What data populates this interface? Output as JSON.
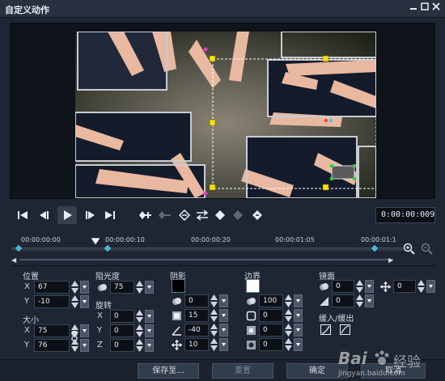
{
  "window": {
    "title": "自定义动作",
    "min_icon": "minimize-icon",
    "max_icon": "maximize-icon",
    "close_icon": "close-icon"
  },
  "transport": {
    "timecode": "0:00:00:009"
  },
  "timeline": {
    "ticks": [
      "00:00:00:00",
      "00:00:00:10",
      "00:00:00:20",
      "00:00:01:05",
      "00:00:01:1"
    ]
  },
  "properties": {
    "position": {
      "label": "位置",
      "x_label": "X",
      "x": "67",
      "y_label": "Y",
      "y": "-10"
    },
    "size": {
      "label": "大小",
      "x_label": "X",
      "x": "75",
      "y_label": "Y",
      "y": "76"
    },
    "opacity": {
      "label": "阻光度",
      "value": "75"
    },
    "rotation": {
      "label": "旋转",
      "x_label": "X",
      "x": "0",
      "y_label": "Y",
      "y": "0",
      "z_label": "Z",
      "z": "0"
    },
    "shadow": {
      "label": "阴影",
      "color": "#000000",
      "opacity": "0",
      "blur": "15",
      "angle": "-40",
      "distance": "10"
    },
    "border": {
      "label": "边界",
      "color": "#ffffff",
      "opacity": "100",
      "width": "0",
      "blur": "0",
      "radius": "0"
    },
    "mirror": {
      "label": "镜面",
      "opacity": "0",
      "offset": "0",
      "fade": "0"
    },
    "ease": {
      "label": "缓入/缓出"
    }
  },
  "footer": {
    "save_as": "保存至...",
    "reset": "重置",
    "ok": "确定",
    "cancel": "取消"
  },
  "watermark": {
    "brand": "Bai",
    "brand2": "经验",
    "site": "jingyan.baidu.com"
  },
  "colors": {
    "accent_keyframe": "#49b8d8",
    "handle": "#f5e20a"
  }
}
